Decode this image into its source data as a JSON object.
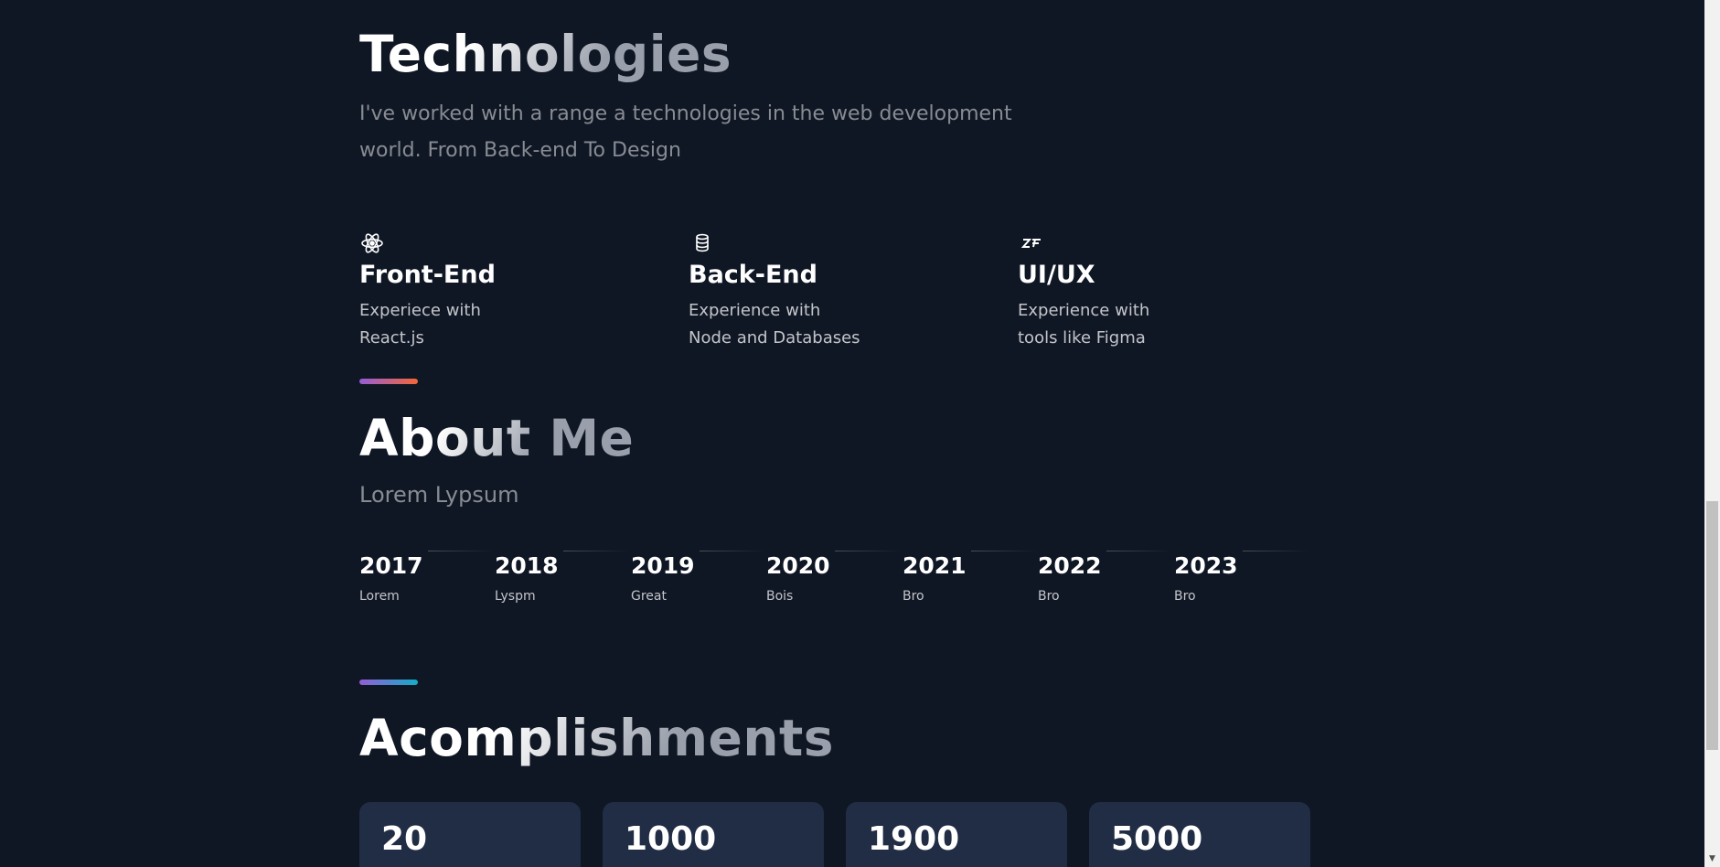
{
  "technologies": {
    "title": "Technologies",
    "description": "I've worked with a range a technologies in the web development world. From Back-end To Design",
    "items": [
      {
        "icon": "react-icon",
        "name": "Front-End",
        "line1": "Experiece with",
        "line2": "React.js"
      },
      {
        "icon": "database-icon",
        "name": "Back-End",
        "line1": "Experience with",
        "line2": "Node and Databases"
      },
      {
        "icon": "zeplin-icon",
        "name": "UI/UX",
        "line1": "Experience with",
        "line2": "tools like Figma"
      }
    ]
  },
  "about": {
    "title": "About Me",
    "subtitle": "Lorem Lypsum",
    "timeline": [
      {
        "year": "2017",
        "text": "Lorem"
      },
      {
        "year": "2018",
        "text": "Lyspm"
      },
      {
        "year": "2019",
        "text": "Great"
      },
      {
        "year": "2020",
        "text": "Bois"
      },
      {
        "year": "2021",
        "text": "Bro"
      },
      {
        "year": "2022",
        "text": "Bro"
      },
      {
        "year": "2023",
        "text": "Bro"
      }
    ]
  },
  "accomplishments": {
    "title": "Acomplishments",
    "cards": [
      {
        "number": "20"
      },
      {
        "number": "1000"
      },
      {
        "number": "1900"
      },
      {
        "number": "5000"
      }
    ]
  },
  "colors": {
    "background": "#0f1624",
    "card": "#212d45",
    "divider_1": [
      "#945dd6",
      "#f46737"
    ],
    "divider_2": [
      "#945dd6",
      "#13adc7"
    ]
  }
}
